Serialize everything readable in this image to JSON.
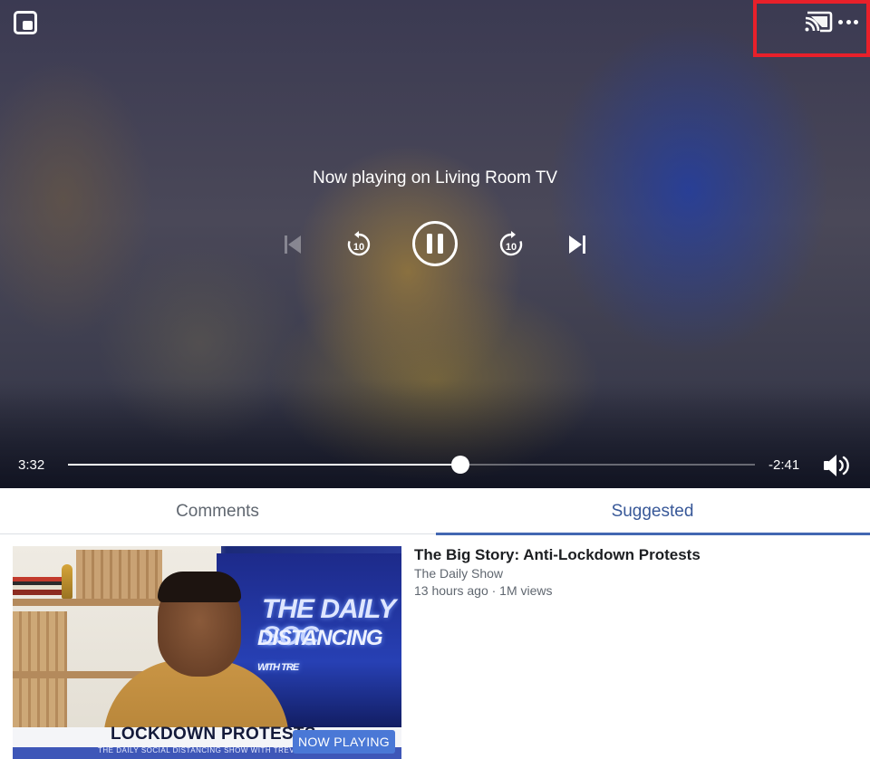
{
  "player": {
    "cast_status": "Now playing on Living Room TV",
    "time_elapsed": "3:32",
    "time_remaining": "-2:41",
    "progress": 0.571,
    "rewind_seconds": "10",
    "forward_seconds": "10"
  },
  "tabs": [
    {
      "label": "Comments",
      "selected": false
    },
    {
      "label": "Suggested",
      "selected": true
    }
  ],
  "suggested": [
    {
      "title": "The Big Story: Anti-Lockdown Protests",
      "channel": "The Daily Show",
      "meta": "13 hours ago · 1M views",
      "badge": "NOW PLAYING",
      "thumbnail_text": {
        "screen_line1": "THE DAILY SOC",
        "screen_line2": "DISTANCING",
        "screen_line3": "WITH TRE",
        "headline": "LOCKDOWN PROTESTS",
        "subline": "THE DAILY SOCIAL DISTANCING SHOW WITH TREVOR"
      }
    }
  ],
  "colors": {
    "accent": "#385898",
    "tab_underline": "#4267b2",
    "highlight": "#e8202a",
    "badge": "#4a78d6"
  },
  "icons": {
    "pip": "picture-in-picture-icon",
    "cast": "cast-icon",
    "more": "more-icon",
    "prev": "skip-previous-icon",
    "rewind": "rewind-10-icon",
    "pause": "pause-icon",
    "forward": "forward-10-icon",
    "next": "skip-next-icon",
    "volume": "volume-icon"
  }
}
